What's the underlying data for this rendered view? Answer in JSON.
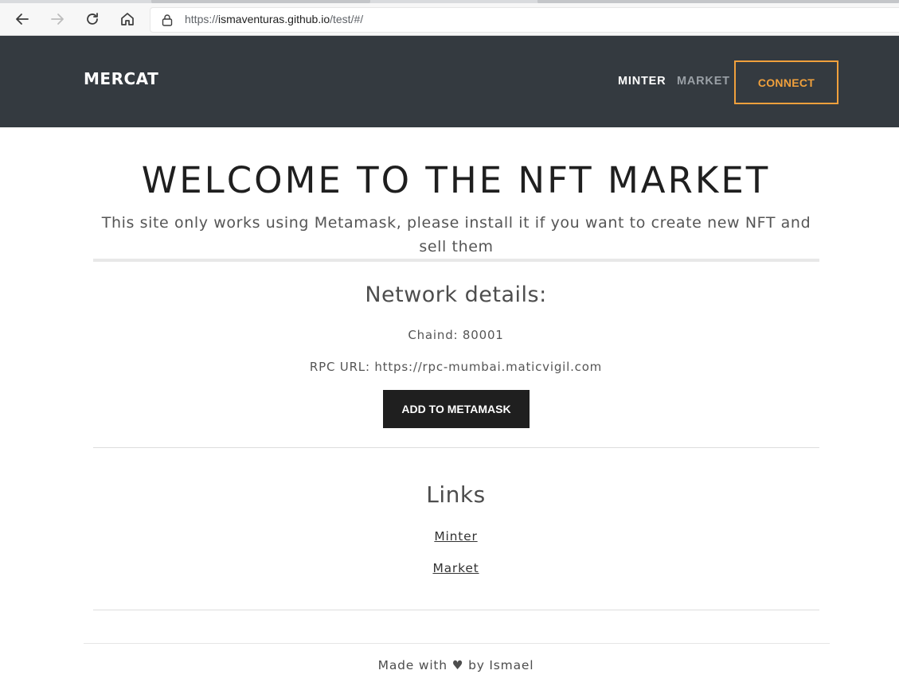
{
  "browser": {
    "url_host": "ismaventuras.github.io",
    "url_scheme": "https://",
    "url_path": "/test/#/",
    "icons": [
      "back-arrow-icon",
      "forward-arrow-icon",
      "reload-icon",
      "home-icon",
      "lock-icon"
    ]
  },
  "header": {
    "brand": "MERCAT",
    "nav": {
      "minter": "MINTER",
      "market": "MARKET"
    },
    "connect_label": "CONNECT",
    "accent_color": "#f0a03c",
    "background_color": "#343a40"
  },
  "main": {
    "title": "WELCOME TO THE NFT MARKET",
    "intro": "This site only works using Metamask, please install it if you want to create new NFT and sell them",
    "network": {
      "heading": "Network details:",
      "chain": "Chaind: 80001",
      "rpc": "RPC URL: https://rpc-mumbai.maticvigil.com",
      "button_label": "ADD TO METAMASK"
    },
    "links": {
      "heading": "Links",
      "minter": "Minter",
      "market": "Market"
    }
  },
  "footer": {
    "text": "Made with ♥ by Ismael"
  }
}
